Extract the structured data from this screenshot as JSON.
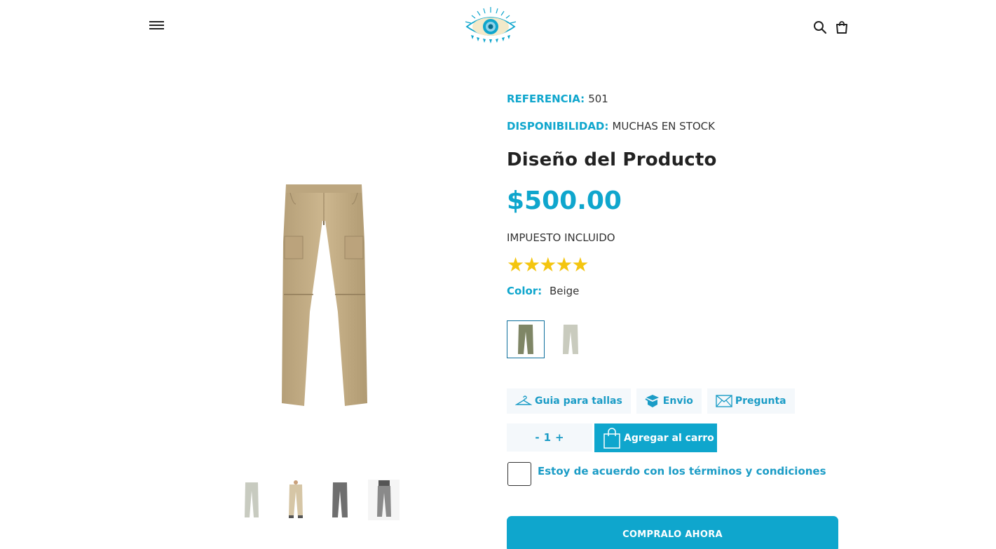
{
  "header": {
    "menu_icon": "hamburger-menu-icon",
    "logo_icon": "eye-logo",
    "search_icon": "search-icon",
    "cart_icon": "shopping-bag-icon"
  },
  "product": {
    "reference_label": "REFERENCIA:",
    "reference_value": "501",
    "availability_label": "DISPONIBILIDAD:",
    "availability_value": "MUCHAS EN STOCK",
    "title": "Diseño del Producto",
    "price": "$500.00",
    "tax_note": "IMPUESTO INCLUIDO",
    "rating": 5,
    "rating_max": 5,
    "stars": "★★★★★",
    "color_label": "Color:",
    "color_value": "Beige",
    "swatches": [
      "olive",
      "light-gray"
    ],
    "selected_swatch": 0
  },
  "gallery": {
    "thumb_count": 4
  },
  "actions": {
    "size_guide_label": "Guia para tallas",
    "shipping_label": "Envio",
    "question_label": "Pregunta"
  },
  "purchase": {
    "qty_minus": "-",
    "qty_value": "1",
    "qty_plus": "+",
    "add_to_cart_label": "Agregar al carro",
    "terms_label": "Estoy de acuerdo con los términos y condiciones",
    "buy_now_label": "COMPRALO AHORA"
  },
  "colors": {
    "accent": "#0fa6cd",
    "star": "#f4c50f",
    "pill_bg": "#f4f8fb"
  }
}
